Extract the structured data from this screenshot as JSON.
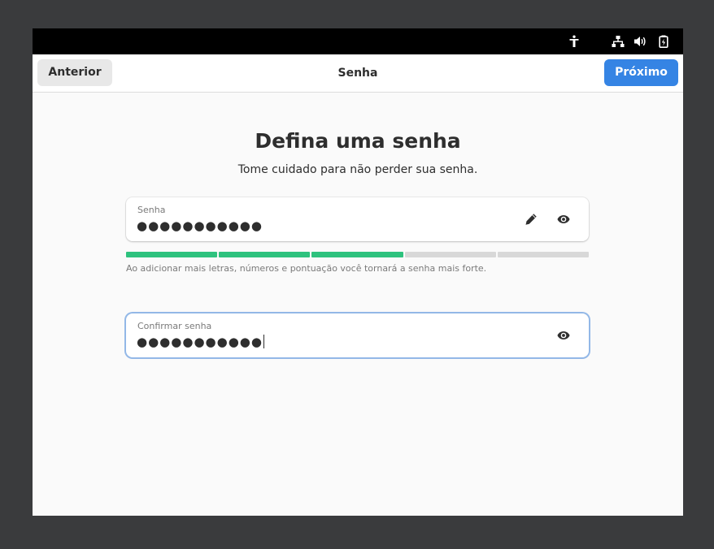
{
  "topbar": {
    "icons": [
      "accessibility-icon",
      "network-icon",
      "volume-icon",
      "battery-icon"
    ]
  },
  "header": {
    "back_label": "Anterior",
    "title": "Senha",
    "next_label": "Próximo"
  },
  "main": {
    "title": "Defina uma senha",
    "subtitle": "Tome cuidado para não perder sua senha.",
    "password": {
      "label": "Senha",
      "value": "●●●●●●●●●●●"
    },
    "strength": {
      "segments_total": 5,
      "segments_filled": 3,
      "color_filled": "#2ec27e",
      "color_empty": "#d8d8d8",
      "hint": "Ao adicionar mais letras, números e pontuação você tornará a senha mais forte."
    },
    "confirm": {
      "label": "Confirmar senha",
      "value": "●●●●●●●●●●●"
    }
  },
  "colors": {
    "accent": "#3584e4",
    "focus_ring": "#93b8e7"
  }
}
